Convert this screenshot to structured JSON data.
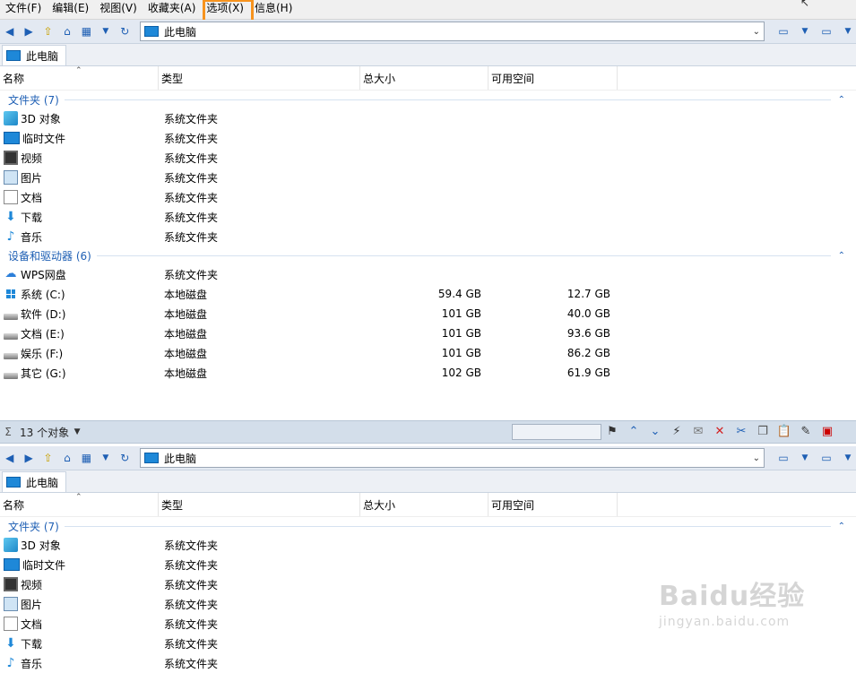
{
  "menu": {
    "items": [
      "文件(F)",
      "编辑(E)",
      "视图(V)",
      "收藏夹(A)",
      "选项(X)",
      "信息(H)"
    ],
    "highlighted_index": 4
  },
  "pane_top": {
    "address": "此电脑",
    "tab": "此电脑",
    "columns": [
      "名称",
      "类型",
      "总大小",
      "可用空间"
    ],
    "groups": [
      {
        "title": "文件夹 (7)",
        "rows": [
          {
            "icon": "3d-objects-icon",
            "name": "3D 对象",
            "type": "系统文件夹",
            "total": "",
            "free": ""
          },
          {
            "icon": "desktop-icon",
            "name": "临时文件",
            "type": "系统文件夹",
            "total": "",
            "free": ""
          },
          {
            "icon": "video-icon",
            "name": "视频",
            "type": "系统文件夹",
            "total": "",
            "free": ""
          },
          {
            "icon": "image-icon",
            "name": "图片",
            "type": "系统文件夹",
            "total": "",
            "free": ""
          },
          {
            "icon": "document-icon",
            "name": "文档",
            "type": "系统文件夹",
            "total": "",
            "free": ""
          },
          {
            "icon": "download-icon",
            "name": "下载",
            "type": "系统文件夹",
            "total": "",
            "free": ""
          },
          {
            "icon": "music-icon",
            "name": "音乐",
            "type": "系统文件夹",
            "total": "",
            "free": ""
          }
        ]
      },
      {
        "title": "设备和驱动器 (6)",
        "rows": [
          {
            "icon": "cloud-icon",
            "name": "WPS网盘",
            "type": "系统文件夹",
            "total": "",
            "free": ""
          },
          {
            "icon": "windows-drive-icon",
            "name": "系统 (C:)",
            "type": "本地磁盘",
            "total": "59.4 GB",
            "free": "12.7 GB"
          },
          {
            "icon": "drive-icon",
            "name": "软件 (D:)",
            "type": "本地磁盘",
            "total": "101 GB",
            "free": "40.0 GB"
          },
          {
            "icon": "drive-icon",
            "name": "文档 (E:)",
            "type": "本地磁盘",
            "total": "101 GB",
            "free": "93.6 GB"
          },
          {
            "icon": "drive-icon",
            "name": "娱乐 (F:)",
            "type": "本地磁盘",
            "total": "101 GB",
            "free": "86.2 GB"
          },
          {
            "icon": "drive-icon",
            "name": "其它 (G:)",
            "type": "本地磁盘",
            "total": "102 GB",
            "free": "61.9 GB"
          }
        ]
      }
    ]
  },
  "status": {
    "count": "13 个对象"
  },
  "pane_bottom": {
    "address": "此电脑",
    "tab": "此电脑",
    "columns": [
      "名称",
      "类型",
      "总大小",
      "可用空间"
    ],
    "groups": [
      {
        "title": "文件夹 (7)",
        "rows": [
          {
            "icon": "3d-objects-icon",
            "name": "3D 对象",
            "type": "系统文件夹"
          },
          {
            "icon": "desktop-icon",
            "name": "临时文件",
            "type": "系统文件夹"
          },
          {
            "icon": "video-icon",
            "name": "视频",
            "type": "系统文件夹"
          },
          {
            "icon": "image-icon",
            "name": "图片",
            "type": "系统文件夹"
          },
          {
            "icon": "document-icon",
            "name": "文档",
            "type": "系统文件夹"
          },
          {
            "icon": "download-icon",
            "name": "下载",
            "type": "系统文件夹"
          },
          {
            "icon": "music-icon",
            "name": "音乐",
            "type": "系统文件夹"
          }
        ]
      }
    ]
  },
  "watermark": {
    "logo": "Baidu经验",
    "sub": "jingyan.baidu.com"
  },
  "colors": {
    "accent": "#1e5fb4",
    "highlight": "#f7931e",
    "toolbar": "#e3e9f2",
    "status": "#d3deea"
  }
}
